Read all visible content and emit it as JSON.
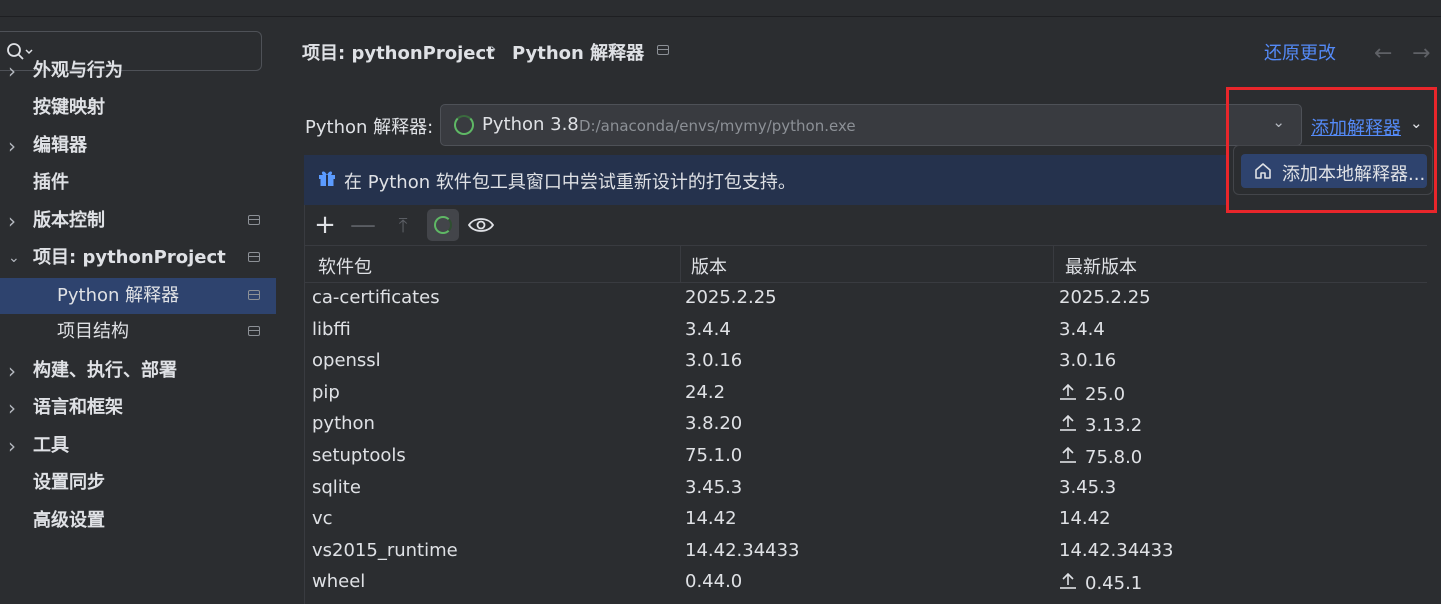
{
  "sidebar": {
    "search_placeholder": "",
    "items": [
      {
        "label": "外观与行为",
        "expandable": true,
        "pinned": false
      },
      {
        "label": "按键映射",
        "expandable": false,
        "pinned": false
      },
      {
        "label": "编辑器",
        "expandable": true,
        "pinned": false
      },
      {
        "label": "插件",
        "expandable": false,
        "pinned": false
      },
      {
        "label": "版本控制",
        "expandable": true,
        "pinned": true
      },
      {
        "label": "项目: pythonProject",
        "expandable": true,
        "expanded": true,
        "pinned": true
      },
      {
        "label": "Python 解释器",
        "sub": true,
        "selected": true,
        "pinned": true
      },
      {
        "label": "项目结构",
        "sub": true,
        "pinned": true
      },
      {
        "label": "构建、执行、部署",
        "expandable": true,
        "pinned": false
      },
      {
        "label": "语言和框架",
        "expandable": true,
        "pinned": false
      },
      {
        "label": "工具",
        "expandable": true,
        "pinned": false
      },
      {
        "label": "设置同步",
        "expandable": false,
        "pinned": false
      },
      {
        "label": "高级设置",
        "expandable": false,
        "pinned": false
      }
    ]
  },
  "header": {
    "breadcrumb_project": "项目: pythonProject",
    "breadcrumb_separator": "›",
    "breadcrumb_page": "Python 解释器",
    "restore_label": "还原更改"
  },
  "interpreter": {
    "label": "Python 解释器:",
    "selected_name": "Python 3.8",
    "selected_path": "D:/anaconda/envs/mymy/python.exe",
    "add_interpreter_label": "添加解释器"
  },
  "banner": {
    "text": "在 Python 软件包工具窗口中尝试重新设计的打包支持。"
  },
  "popup": {
    "item_label": "添加本地解释器..."
  },
  "packages": {
    "columns": [
      "软件包",
      "版本",
      "最新版本"
    ],
    "rows": [
      {
        "name": "ca-certificates",
        "version": "2025.2.25",
        "latest": "2025.2.25",
        "upgrade": false
      },
      {
        "name": "libffi",
        "version": "3.4.4",
        "latest": "3.4.4",
        "upgrade": false
      },
      {
        "name": "openssl",
        "version": "3.0.16",
        "latest": "3.0.16",
        "upgrade": false
      },
      {
        "name": "pip",
        "version": "24.2",
        "latest": "25.0",
        "upgrade": true
      },
      {
        "name": "python",
        "version": "3.8.20",
        "latest": "3.13.2",
        "upgrade": true
      },
      {
        "name": "setuptools",
        "version": "75.1.0",
        "latest": "75.8.0",
        "upgrade": true
      },
      {
        "name": "sqlite",
        "version": "3.45.3",
        "latest": "3.45.3",
        "upgrade": false
      },
      {
        "name": "vc",
        "version": "14.42",
        "latest": "14.42",
        "upgrade": false
      },
      {
        "name": "vs2015_runtime",
        "version": "14.42.34433",
        "latest": "14.42.34433",
        "upgrade": false
      },
      {
        "name": "wheel",
        "version": "0.44.0",
        "latest": "0.45.1",
        "upgrade": true
      }
    ]
  },
  "colors": {
    "accent_link": "#548af7",
    "selection": "#2e436e",
    "highlight_box": "#e8262b",
    "spinner": "#5fb865"
  }
}
